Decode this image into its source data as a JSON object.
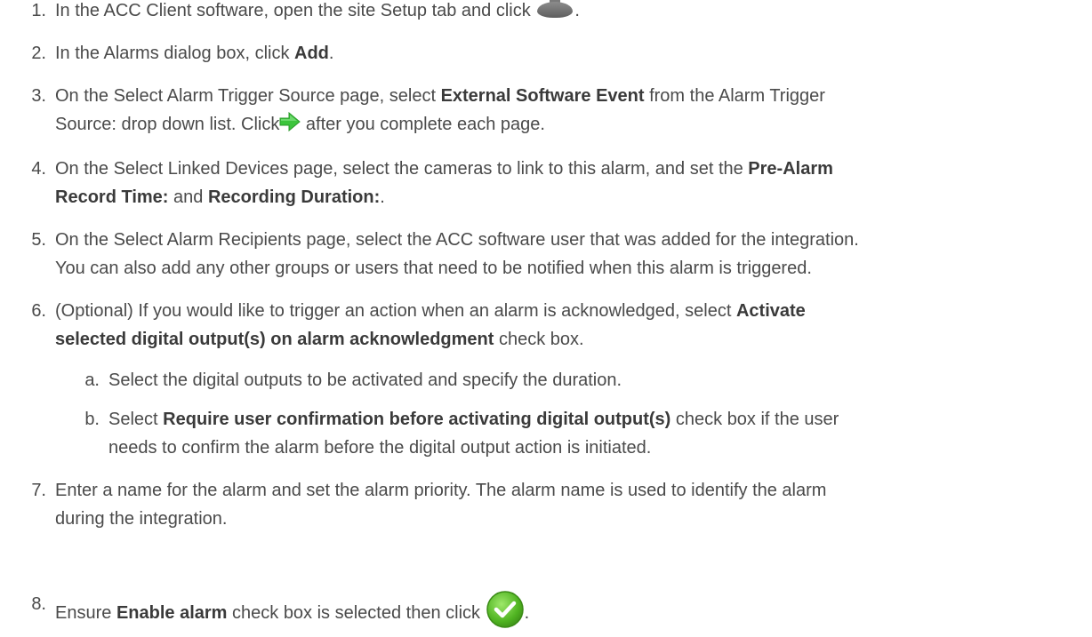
{
  "steps": {
    "s1": {
      "num": "1.",
      "text_before": "In the ACC Client software, open the site Setup tab and click",
      "text_after": "."
    },
    "s2": {
      "num": "2.",
      "t1": "In the Alarms dialog box, click ",
      "b1": "Add",
      "t2": "."
    },
    "s3": {
      "num": "3.",
      "t1": "On the Select Alarm Trigger Source page, select ",
      "b1": "External Software Event",
      "t2": " from the Alarm Trigger",
      "t3": "Source: drop down list. Click",
      "t4": " after you complete each page."
    },
    "s4": {
      "num": "4.",
      "t1": "On the Select Linked Devices page, select the cameras to link to this alarm, and set the ",
      "b1": "Pre-Alarm",
      "b2": "Record Time:",
      "t2": " and ",
      "b3": "Recording Duration:",
      "t3": "."
    },
    "s5": {
      "num": "5.",
      "l1": "On the Select Alarm Recipients page, select the ACC software user that was added for the integration.",
      "l2": "You can also add any other groups or users that need to be notified when this alarm is triggered."
    },
    "s6": {
      "num": "6.",
      "t1": "(Optional) If you would like to trigger an action when an alarm is acknowledged, select ",
      "b1": "Activate",
      "b2": "selected digital output(s) on alarm acknowledgment",
      "t2": " check box."
    },
    "s6a": {
      "num": "a.",
      "text": "Select the digital outputs to be activated and specify the duration."
    },
    "s6b": {
      "num": "b.",
      "t1": "Select ",
      "b1": "Require user confirmation before activating digital output(s)",
      "t2": " check box if the user",
      "l2": "needs to confirm the alarm before the digital output action is initiated."
    },
    "s7": {
      "num": "7.",
      "l1": "Enter a name for the alarm and set the alarm priority. The alarm name is used to identify the alarm",
      "l2": "during the integration."
    },
    "s8": {
      "num": "8.",
      "t1": "Ensure ",
      "b1": "Enable alarm",
      "t2": " check box is selected then click",
      "t3": "."
    }
  },
  "icons": {
    "setup_icon": "alarm-bell-icon",
    "next_icon": "green-arrow-icon",
    "ok_icon": "green-check-icon"
  },
  "colors": {
    "text": "#4a4a4a",
    "arrow_green": "#3cc43c",
    "check_green": "#5bbf2a"
  }
}
